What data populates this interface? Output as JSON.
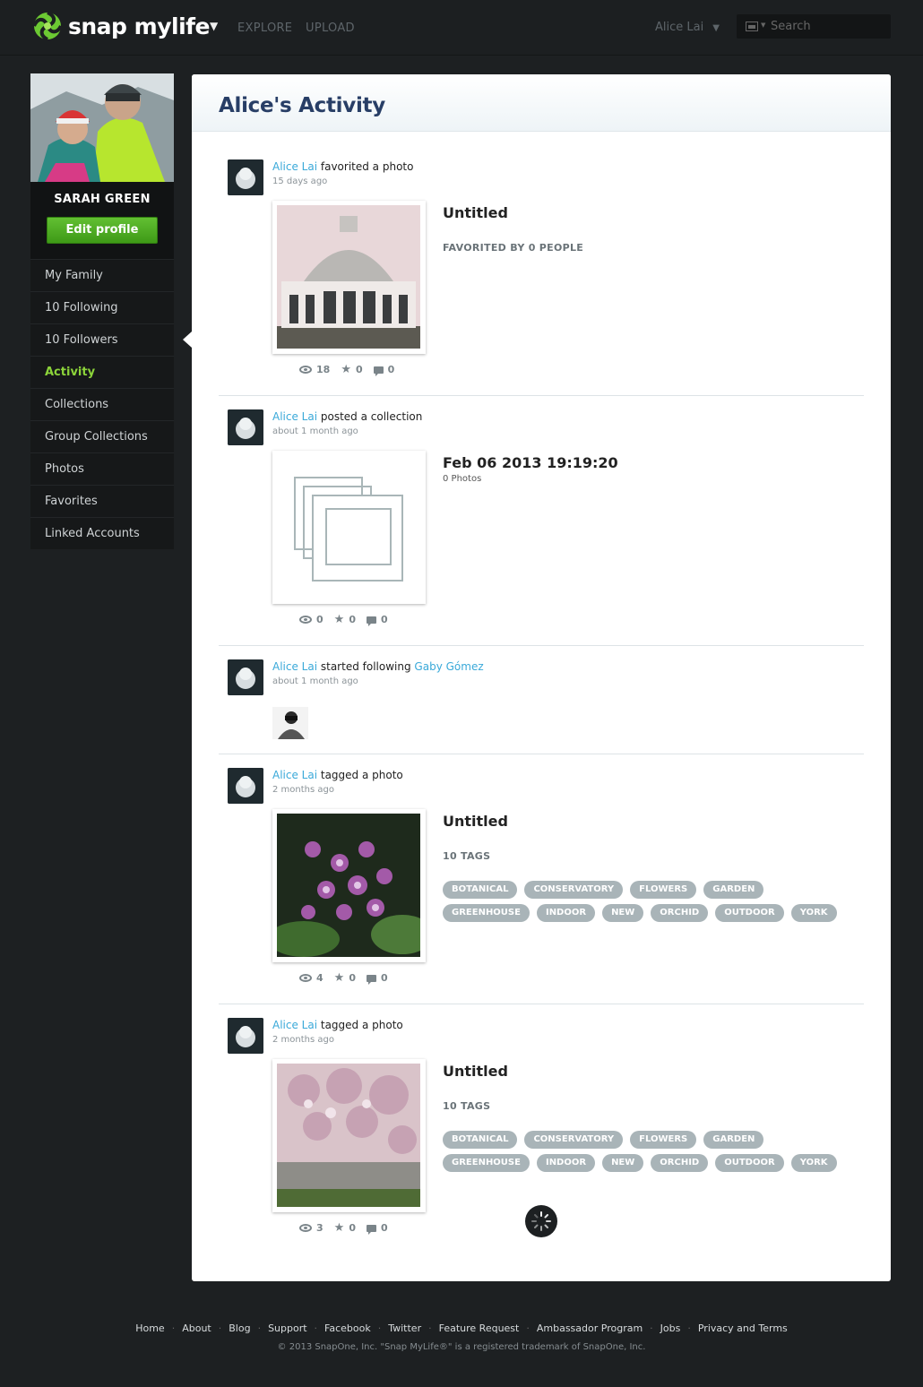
{
  "header": {
    "logo_text": "snap mylife",
    "logo_caret": "▼",
    "nav": [
      "EXPLORE",
      "UPLOAD"
    ],
    "user_name": "Alice Lai",
    "user_caret": "▼",
    "search_placeholder": "Search"
  },
  "sidebar": {
    "profile_name": "SARAH GREEN",
    "edit_label": "Edit profile",
    "items": [
      {
        "label": "My Family"
      },
      {
        "label": "10 Following"
      },
      {
        "label": "10 Followers"
      },
      {
        "label": "Activity",
        "active": true
      },
      {
        "label": "Collections"
      },
      {
        "label": "Group Collections"
      },
      {
        "label": "Photos"
      },
      {
        "label": "Favorites"
      },
      {
        "label": "Linked Accounts"
      }
    ]
  },
  "main": {
    "title": "Alice's Activity",
    "activities": [
      {
        "user": "Alice Lai",
        "action": "favorited a photo",
        "ago": "15 days ago",
        "title": "Untitled",
        "sub": "FAVORITED BY 0 PEOPLE",
        "views": "18",
        "favs": "0",
        "comments": "0"
      },
      {
        "user": "Alice Lai",
        "action": "posted a collection",
        "ago": "about 1 month ago",
        "title": "Feb 06 2013 19:19:20",
        "small": "0 Photos",
        "views": "0",
        "favs": "0",
        "comments": "0"
      },
      {
        "user": "Alice Lai",
        "action": "started following",
        "target": "Gaby Gómez",
        "ago": "about 1 month ago"
      },
      {
        "user": "Alice Lai",
        "action": "tagged a photo",
        "ago": "2 months ago",
        "title": "Untitled",
        "sub": "10 TAGS",
        "views": "4",
        "favs": "0",
        "comments": "0",
        "tags": [
          "BOTANICAL",
          "CONSERVATORY",
          "FLOWERS",
          "GARDEN",
          "GREENHOUSE",
          "INDOOR",
          "NEW",
          "ORCHID",
          "OUTDOOR",
          "YORK"
        ]
      },
      {
        "user": "Alice Lai",
        "action": "tagged a photo",
        "ago": "2 months ago",
        "title": "Untitled",
        "sub": "10 TAGS",
        "views": "3",
        "favs": "0",
        "comments": "0",
        "tags": [
          "BOTANICAL",
          "CONSERVATORY",
          "FLOWERS",
          "GARDEN",
          "GREENHOUSE",
          "INDOOR",
          "NEW",
          "ORCHID",
          "OUTDOOR",
          "YORK"
        ]
      }
    ]
  },
  "icons": {
    "star": "★"
  },
  "footer": {
    "links": [
      "Home",
      "About",
      "Blog",
      "Support",
      "Facebook",
      "Twitter",
      "Feature Request",
      "Ambassador Program",
      "Jobs",
      "Privacy and Terms"
    ],
    "separator": "·",
    "copyright": "© 2013 SnapOne, Inc. \"Snap MyLife®\" is a registered trademark of SnapOne, Inc."
  },
  "colors": {
    "accent": "#8cd43a",
    "link": "#3aa9d9",
    "title": "#283e66",
    "tag": "#a9b4b8",
    "edit_button": "#4fae22"
  }
}
